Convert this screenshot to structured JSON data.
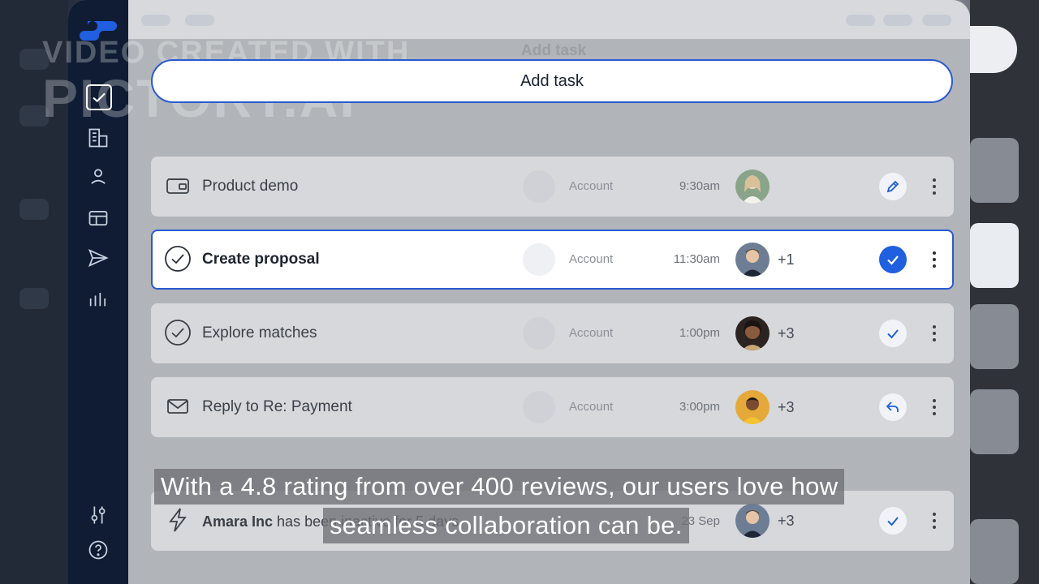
{
  "watermark": {
    "line1": "VIDEO CREATED WITH",
    "line2": "PICTORY.AI"
  },
  "header": {
    "add_task_label": "Add task",
    "ghost_title": "Add task"
  },
  "tasks": [
    {
      "name": "Product demo",
      "account": "Account",
      "time": "9:30am",
      "more": "",
      "icon": "wallet-icon",
      "action_icon": "pencil-icon",
      "avatar_color": "#e8dcc4"
    },
    {
      "name": "Create proposal",
      "account": "Account",
      "time": "11:30am",
      "more": "+1",
      "icon": "check-circle-icon",
      "action_icon": "check-icon",
      "avatar_color": "#5a6c84"
    },
    {
      "name": "Explore matches",
      "account": "Account",
      "time": "1:00pm",
      "more": "+3",
      "icon": "check-circle-icon",
      "action_icon": "check-icon",
      "avatar_color": "#3b2a22"
    },
    {
      "name": "Reply to Re: Payment",
      "account": "Account",
      "time": "3:00pm",
      "more": "+3",
      "icon": "mail-icon",
      "action_icon": "reply-icon",
      "avatar_color": "#b98a3a"
    }
  ],
  "alert_task": {
    "company": "Amara Inc",
    "text": " has been inactive for 5 days",
    "date": "23 Sep",
    "more": "+3",
    "icon": "lightning-icon",
    "action_icon": "check-icon"
  },
  "caption": {
    "line1": "With a 4.8 rating from over 400 reviews, our users love how",
    "line2": "seamless collaboration can be."
  },
  "colors": {
    "accent": "#1f5fe0",
    "sidebar": "#0f1c33",
    "border_accent": "#2a5ad0"
  }
}
